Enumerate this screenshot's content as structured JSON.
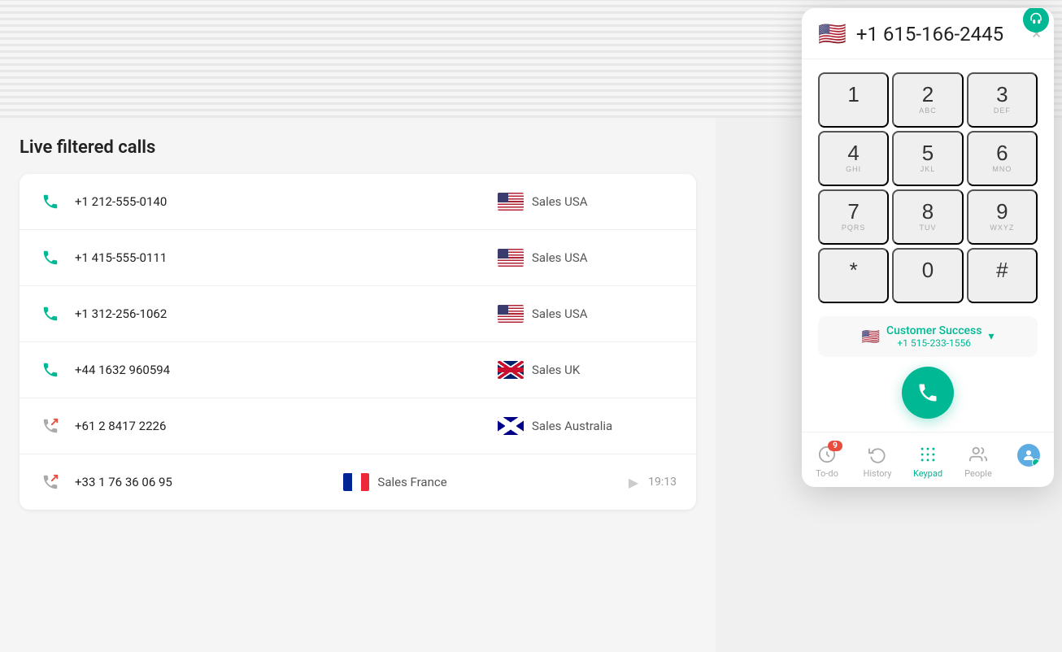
{
  "page": {
    "title": "Live filtered calls"
  },
  "calls": [
    {
      "number": "+1 212-555-0140",
      "flag": "us",
      "label": "Sales USA",
      "type": "incoming",
      "time": null,
      "play": false
    },
    {
      "number": "+1 415-555-0111",
      "flag": "us",
      "label": "Sales USA",
      "type": "incoming",
      "time": null,
      "play": false
    },
    {
      "number": "+1 312-256-1062",
      "flag": "us",
      "label": "Sales USA",
      "type": "incoming",
      "time": null,
      "play": false
    },
    {
      "number": "+44 1632 960594",
      "flag": "uk",
      "label": "Sales UK",
      "type": "incoming",
      "time": null,
      "play": false
    },
    {
      "number": "+61 2 8417 2226",
      "flag": "au",
      "label": "Sales Australia",
      "type": "outgoing",
      "time": null,
      "play": false
    },
    {
      "number": "+33 1 76 36 06 95",
      "flag": "fr",
      "label": "Sales France",
      "type": "outgoing",
      "time": "19:13",
      "play": true
    }
  ],
  "dialer": {
    "phone_number": "+1 615-166-2445",
    "flag": "🇺🇸",
    "close_label": "×",
    "keys": [
      {
        "digit": "1",
        "letters": ""
      },
      {
        "digit": "2",
        "letters": "ABC"
      },
      {
        "digit": "3",
        "letters": "DEF"
      },
      {
        "digit": "4",
        "letters": "GHI"
      },
      {
        "digit": "5",
        "letters": "JKL"
      },
      {
        "digit": "6",
        "letters": "MNO"
      },
      {
        "digit": "7",
        "letters": "PQRS"
      },
      {
        "digit": "8",
        "letters": "TUV"
      },
      {
        "digit": "9",
        "letters": "WXYZ"
      },
      {
        "digit": "*",
        "letters": ""
      },
      {
        "digit": "0",
        "letters": ""
      },
      {
        "digit": "#",
        "letters": ""
      }
    ],
    "from_name": "Customer Success",
    "from_number": "+1 515-233-1556",
    "from_flag": "🇺🇸"
  },
  "nav": {
    "items": [
      {
        "id": "todo",
        "label": "To-do",
        "badge": "9",
        "active": false
      },
      {
        "id": "history",
        "label": "History",
        "badge": null,
        "active": false
      },
      {
        "id": "keypad",
        "label": "Keypad",
        "badge": null,
        "active": true
      },
      {
        "id": "people",
        "label": "People",
        "badge": null,
        "active": false
      },
      {
        "id": "avatar",
        "label": "",
        "badge": null,
        "active": false
      }
    ]
  }
}
